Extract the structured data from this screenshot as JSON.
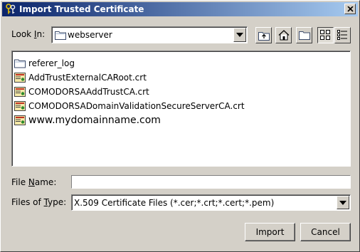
{
  "window": {
    "title": "Import Trusted Certificate",
    "close_label": "×"
  },
  "look_in": {
    "label_prefix": "Look ",
    "label_mnemonic": "I",
    "label_suffix": "n:",
    "value": "webserver",
    "icon": "folder-icon"
  },
  "toolbar": {
    "buttons": [
      {
        "name": "up-one-level-button",
        "icon": "up-folder-icon"
      },
      {
        "name": "home-button",
        "icon": "home-icon"
      },
      {
        "name": "new-folder-button",
        "icon": "new-folder-icon"
      },
      {
        "name": "list-view-button",
        "icon": "list-view-icon",
        "pressed": true
      },
      {
        "name": "details-view-button",
        "icon": "details-view-icon"
      }
    ]
  },
  "files": [
    {
      "name": "referer_log",
      "icon": "folder-icon"
    },
    {
      "name": "AddTrustExternalCARoot.crt",
      "icon": "certificate-icon"
    },
    {
      "name": "COMODORSAAddTrustCA.crt",
      "icon": "certificate-icon"
    },
    {
      "name": "COMODORSADomainValidationSecureServerCA.crt",
      "icon": "certificate-icon"
    },
    {
      "name": "www.mydomainname.com",
      "icon": "certificate-icon"
    }
  ],
  "file_name": {
    "label_prefix": "File ",
    "label_mnemonic": "N",
    "label_suffix": "ame:",
    "value": ""
  },
  "files_of_type": {
    "label_prefix": "Files of ",
    "label_mnemonic": "T",
    "label_suffix": "ype:",
    "value": "X.509 Certificate Files (*.cer;*.crt;*.cert;*.pem)"
  },
  "buttons": {
    "import_label": "Import",
    "cancel_label": "Cancel"
  },
  "colors": {
    "titlebar_start": "#0a246a",
    "titlebar_end": "#a6caf0",
    "dialog_bg": "#d4d0c8"
  }
}
